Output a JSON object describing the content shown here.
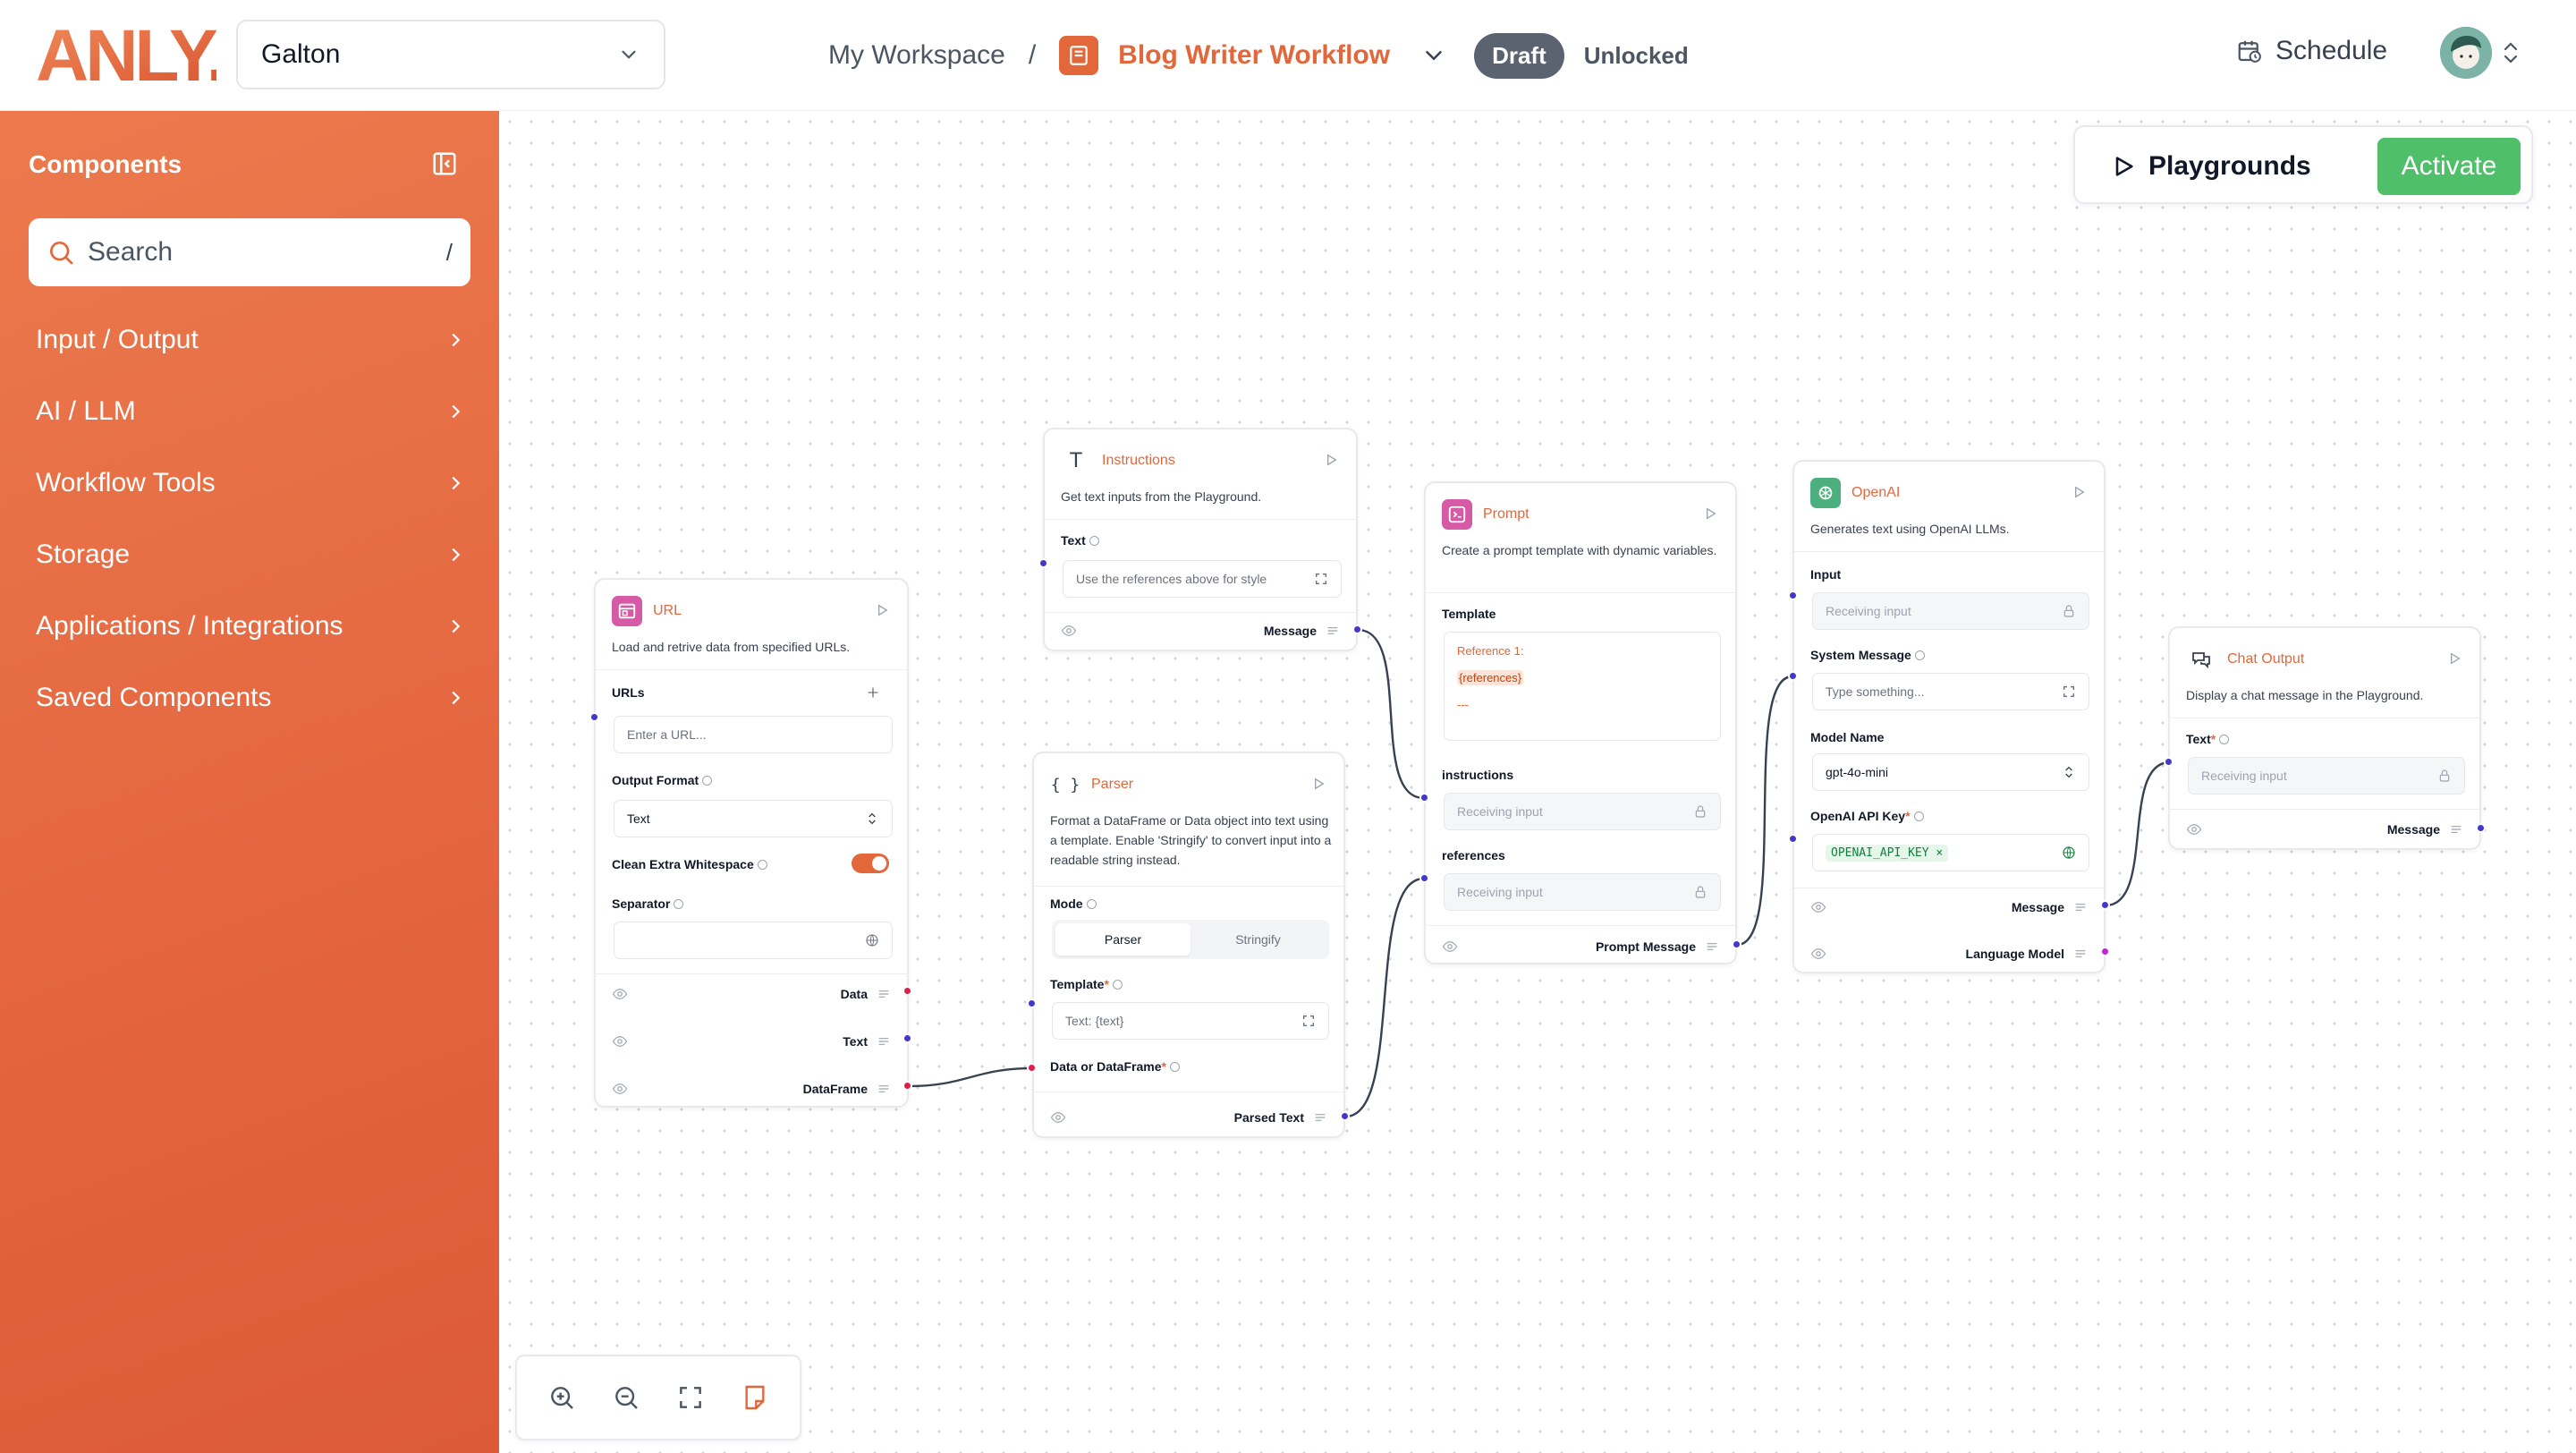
{
  "header": {
    "logo_text": "ANLY.",
    "org_selector": "Galton",
    "workspace": "My Workspace",
    "separator": "/",
    "flow_name": "Blog Writer Workflow",
    "status_badge": "Draft",
    "lock_status": "Unlocked",
    "schedule_label": "Schedule"
  },
  "sidebar": {
    "title": "Components",
    "search_placeholder": "Search",
    "search_shortcut": "/",
    "items": [
      {
        "label": "Input / Output"
      },
      {
        "label": "AI / LLM"
      },
      {
        "label": "Workflow Tools"
      },
      {
        "label": "Storage"
      },
      {
        "label": "Applications / Integrations"
      },
      {
        "label": "Saved Components"
      }
    ]
  },
  "actions": {
    "playgrounds_label": "Playgrounds",
    "activate_label": "Activate"
  },
  "colors": {
    "accent": "#e2673a",
    "activate": "#4fbf6a",
    "handle_blue": "#4338ca",
    "handle_red": "#e11d48",
    "handle_purple": "#c026d3"
  },
  "nodes": {
    "url": {
      "title": "URL",
      "description": "Load and retrive data from specified URLs.",
      "urls_label": "URLs",
      "urls_placeholder": "Enter a URL...",
      "output_format_label": "Output Format",
      "output_format_value": "Text",
      "clean_whitespace_label": "Clean Extra Whitespace",
      "clean_whitespace_on": true,
      "separator_label": "Separator",
      "outputs": [
        "Data",
        "Text",
        "DataFrame"
      ]
    },
    "instructions": {
      "title": "Instructions",
      "description": "Get text inputs from the Playground.",
      "text_label": "Text",
      "text_value": "Use the references above for style",
      "output": "Message"
    },
    "parser": {
      "title": "Parser",
      "description": "Format a DataFrame or Data object into text using a template. Enable 'Stringify' to convert input into a readable string instead.",
      "mode_label": "Mode",
      "mode_options": [
        "Parser",
        "Stringify"
      ],
      "mode_selected": "Parser",
      "template_label": "Template",
      "template_placeholder": "Text: {text}",
      "data_label": "Data or DataFrame",
      "output": "Parsed Text"
    },
    "prompt": {
      "title": "Prompt",
      "description": "Create a prompt template with dynamic variables.",
      "template_label": "Template",
      "template_lines": [
        "Reference 1:",
        "{references}",
        "---"
      ],
      "instructions_label": "instructions",
      "instructions_placeholder": "Receiving input",
      "references_label": "references",
      "references_placeholder": "Receiving input",
      "output": "Prompt Message"
    },
    "openai": {
      "title": "OpenAI",
      "description": "Generates text using OpenAI LLMs.",
      "input_label": "Input",
      "input_placeholder": "Receiving input",
      "system_label": "System Message",
      "system_placeholder": "Type something...",
      "model_label": "Model Name",
      "model_value": "gpt-4o-mini",
      "key_label": "OpenAI API Key",
      "key_value": "OPENAI_API_KEY",
      "outputs": [
        "Message",
        "Language Model"
      ]
    },
    "chat_output": {
      "title": "Chat Output",
      "description": "Display a chat message in the Playground.",
      "text_label": "Text",
      "text_placeholder": "Receiving input",
      "output": "Message"
    }
  }
}
